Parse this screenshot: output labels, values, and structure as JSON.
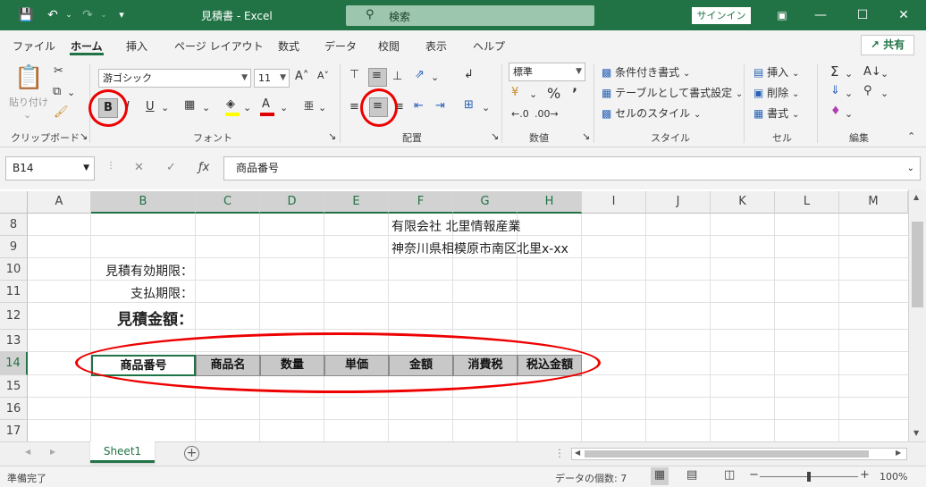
{
  "titlebar": {
    "title": "見積書  -  Excel",
    "search_label": "検索",
    "signin": "サインイン"
  },
  "menu": {
    "tabs": [
      "ファイル",
      "ホーム",
      "挿入",
      "ページ レイアウト",
      "数式",
      "データ",
      "校閲",
      "表示",
      "ヘルプ"
    ],
    "share": "共有"
  },
  "ribbon": {
    "clipboard": {
      "paste": "貼り付け",
      "label": "クリップボード"
    },
    "font": {
      "name": "游ゴシック",
      "size": "11",
      "label": "フォント",
      "bold": "B",
      "italic": "I",
      "underline": "U"
    },
    "alignment": {
      "label": "配置"
    },
    "number": {
      "format": "標準",
      "label": "数値"
    },
    "styles": {
      "conditional": "条件付き書式",
      "table": "テーブルとして書式設定",
      "cell": "セルのスタイル",
      "label": "スタイル"
    },
    "cells": {
      "insert": "挿入",
      "delete": "削除",
      "format": "書式",
      "label": "セル"
    },
    "editing": {
      "label": "編集"
    }
  },
  "formula_bar": {
    "name_box": "B14",
    "formula": "商品番号"
  },
  "grid": {
    "columns": [
      "A",
      "B",
      "C",
      "D",
      "E",
      "F",
      "G",
      "H",
      "I",
      "J",
      "K",
      "L",
      "M"
    ],
    "rows": [
      "8",
      "9",
      "10",
      "11",
      "12",
      "13",
      "14",
      "15",
      "16",
      "17"
    ],
    "cells": {
      "f8": "有限会社 北里情報産業",
      "f9": "神奈川県相模原市南区北里x-xx",
      "b10": "見積有効期限：",
      "b11": "支払期限：",
      "b12": "見積金額："
    },
    "header_row": [
      "商品番号",
      "商品名",
      "数量",
      "単価",
      "金額",
      "消費税",
      "税込金額"
    ]
  },
  "sheets": {
    "tabs": [
      "Sheet1"
    ]
  },
  "status": {
    "ready": "準備完了",
    "count": "データの個数: 7",
    "zoom": "100%"
  },
  "colors": {
    "excel_green": "#217346",
    "annotation_red": "#e00000"
  }
}
